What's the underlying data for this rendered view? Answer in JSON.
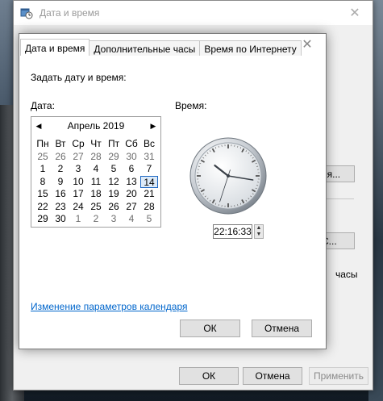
{
  "outer_window": {
    "title": "Дата и время",
    "close_glyph": "✕",
    "right_button_1": "ня...",
    "right_button_2": "С...",
    "right_text": "часы",
    "footer": {
      "ok": "ОК",
      "cancel": "Отмена",
      "apply": "Применить"
    }
  },
  "dialog": {
    "close_glyph": "✕",
    "tabs": [
      {
        "label": "Дата и время"
      },
      {
        "label": "Дополнительные часы"
      },
      {
        "label": "Время по Интернету"
      }
    ],
    "heading": "Задать дату и время:",
    "date_label": "Дата:",
    "time_label": "Время:",
    "calendar": {
      "month_label": "Апрель 2019",
      "prev_glyph": "◀",
      "next_glyph": "▶",
      "weekdays": [
        "Пн",
        "Вт",
        "Ср",
        "Чт",
        "Пт",
        "Сб",
        "Вс"
      ],
      "weeks": [
        [
          "25",
          "26",
          "27",
          "28",
          "29",
          "30",
          "31"
        ],
        [
          "1",
          "2",
          "3",
          "4",
          "5",
          "6",
          "7"
        ],
        [
          "8",
          "9",
          "10",
          "11",
          "12",
          "13",
          "14"
        ],
        [
          "15",
          "16",
          "17",
          "18",
          "19",
          "20",
          "21"
        ],
        [
          "22",
          "23",
          "24",
          "25",
          "26",
          "27",
          "28"
        ],
        [
          "29",
          "30",
          "1",
          "2",
          "3",
          "4",
          "5"
        ]
      ],
      "selected_day": "14"
    },
    "clock": {
      "hours": 22,
      "minutes": 16,
      "seconds": 33
    },
    "time_value": "22:16:33",
    "link": "Изменение параметров календаря",
    "ok": "ОК",
    "cancel": "Отмена"
  }
}
